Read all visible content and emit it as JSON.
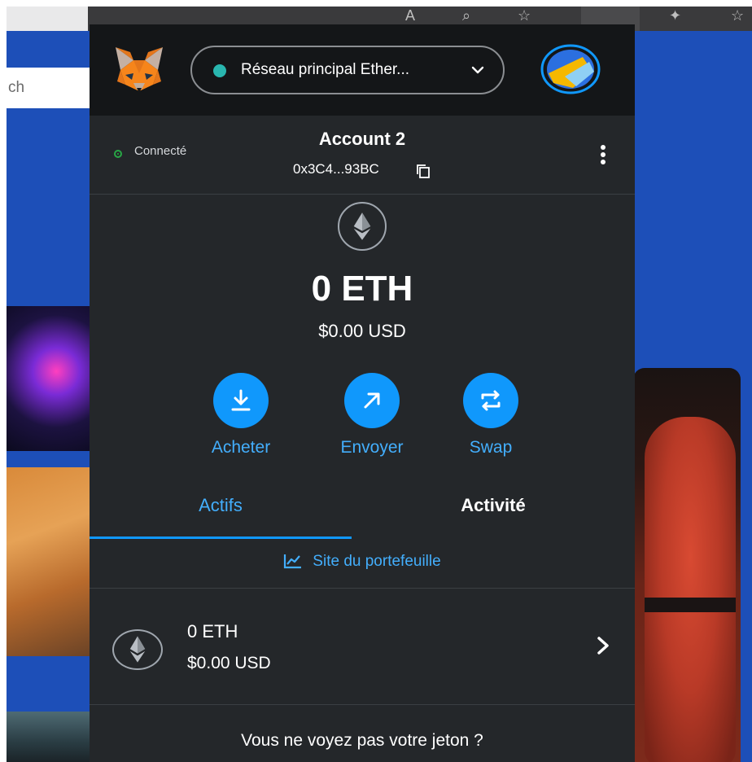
{
  "background_page": {
    "search_text": "ch"
  },
  "popup": {
    "header": {
      "network_label": "Réseau principal Ether...",
      "network_color": "#29b6af"
    },
    "account": {
      "status": "Connecté",
      "name": "Account 2",
      "address": "0x3C4...93BC"
    },
    "balance": {
      "amount": "0 ETH",
      "fiat": "$0.00 USD"
    },
    "actions": [
      {
        "label": "Acheter",
        "icon": "download-icon"
      },
      {
        "label": "Envoyer",
        "icon": "send-arrow-icon"
      },
      {
        "label": "Swap",
        "icon": "swap-icon"
      }
    ],
    "tabs": [
      {
        "label": "Actifs",
        "active": true
      },
      {
        "label": "Activité",
        "active": false
      }
    ],
    "portfolio_link": "Site du portefeuille",
    "assets": [
      {
        "amount": "0 ETH",
        "fiat": "$0.00 USD",
        "icon": "ethereum-icon"
      }
    ],
    "footer": "Vous ne voyez pas votre jeton ?"
  },
  "colors": {
    "accent": "#1098fc",
    "link": "#43aefc",
    "popup_bg": "#24272a",
    "header_bg": "#141618",
    "connected": "#28a745"
  }
}
